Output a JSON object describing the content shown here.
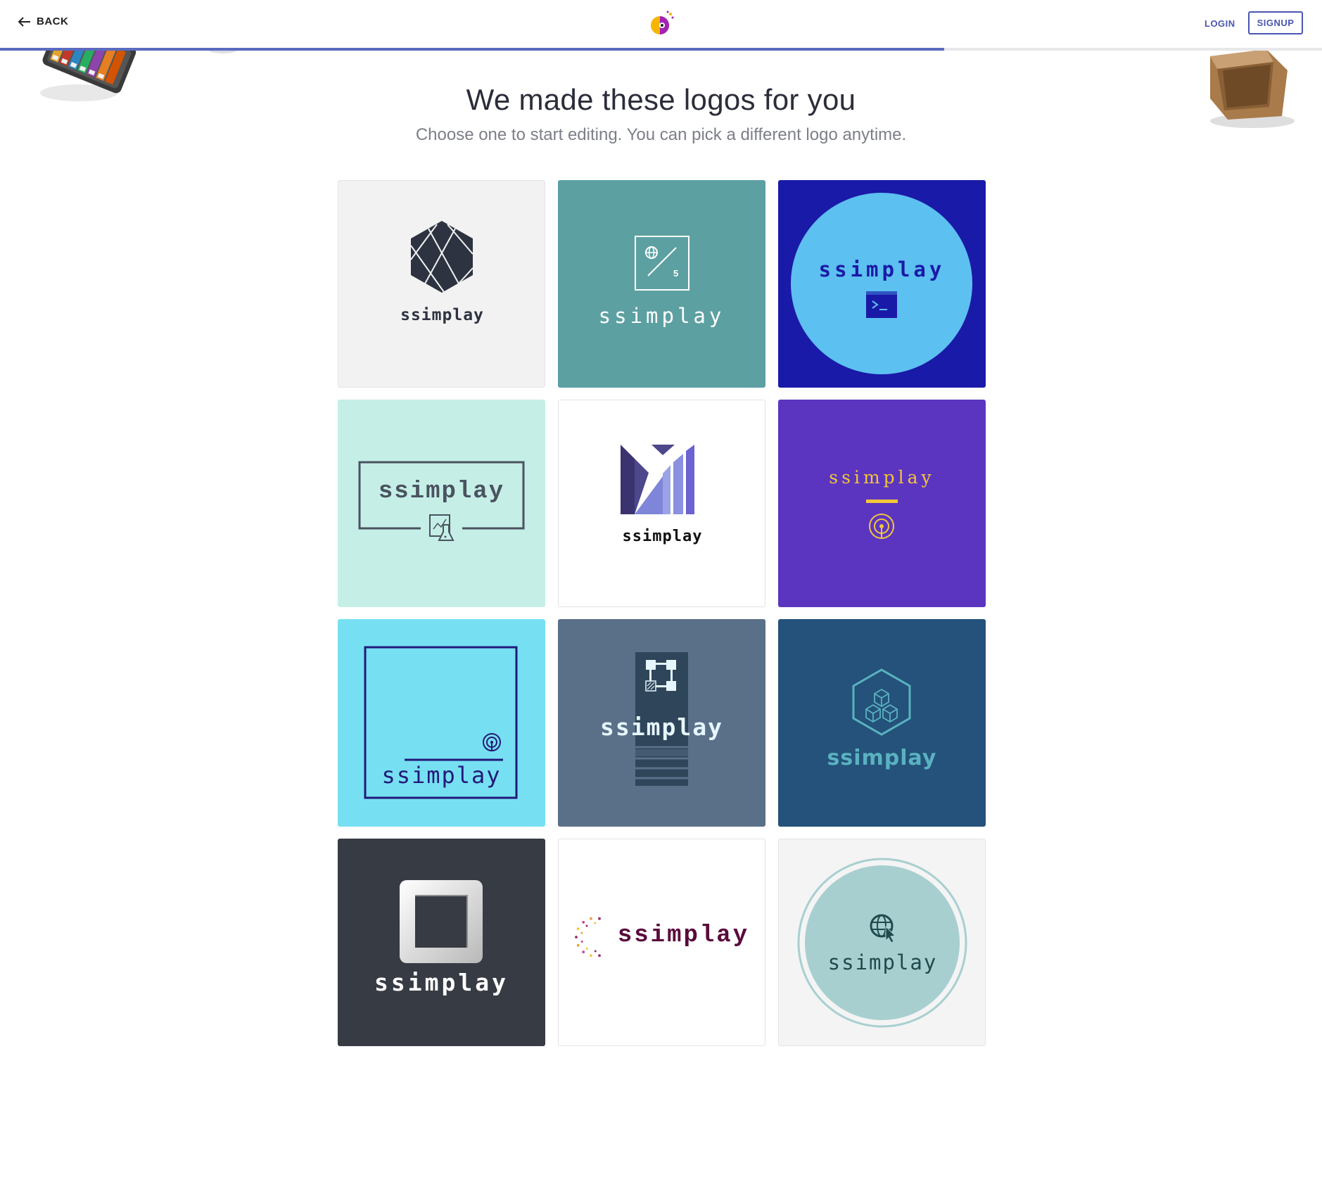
{
  "nav": {
    "back_label": "BACK",
    "login_label": "LOGIN",
    "signup_label": "SIGNUP",
    "progress_fraction": 0.714
  },
  "header": {
    "title": "We made these logos for you",
    "subtitle": "Choose one to start editing. You can pick a different logo anytime."
  },
  "logos": [
    {
      "name": "ssimplay",
      "background": "#f2f2f2",
      "text_color": "#2d3340",
      "icon": "hexagon-icon"
    },
    {
      "name": "ssimplay",
      "background": "#5da0a2",
      "text_color": "#ffffff",
      "icon": "percent-globe-icon",
      "icon_text": "5"
    },
    {
      "name": "ssimplay",
      "background": "#1a1aa8",
      "text_color": "#1a1aa8",
      "icon": "terminal-icon"
    },
    {
      "name": "ssimplay",
      "background": "#c5efe6",
      "text_color": "#4a5260",
      "icon": "lab-document-icon"
    },
    {
      "name": "ssimplay",
      "background": "#ffffff",
      "text_color": "#111111",
      "icon": "m-letter-icon"
    },
    {
      "name": "ssimplay",
      "background": "#5b35c0",
      "text_color": "#f2c63a",
      "icon": "broadcast-icon"
    },
    {
      "name": "ssimplay",
      "background": "#76e0f2",
      "text_color": "#22197a",
      "icon": "broadcast-icon"
    },
    {
      "name": "ssimplay",
      "background": "#5a7089",
      "text_color": "#e6f6ff",
      "icon": "network-icon"
    },
    {
      "name": "ssimplay",
      "background": "#24527a",
      "text_color": "#5ab2c0",
      "icon": "cubes-icon"
    },
    {
      "name": "ssimplay",
      "background": "#373b44",
      "text_color": "#ffffff",
      "icon": "square-frame-icon"
    },
    {
      "name": "ssimplay",
      "background": "#ffffff",
      "text_color": "#5a0a3c",
      "icon": "dots-ring-icon"
    },
    {
      "name": "ssimplay",
      "background": "#f4f4f4",
      "text_color": "#1f4a4e",
      "icon": "globe-cursor-icon"
    }
  ]
}
